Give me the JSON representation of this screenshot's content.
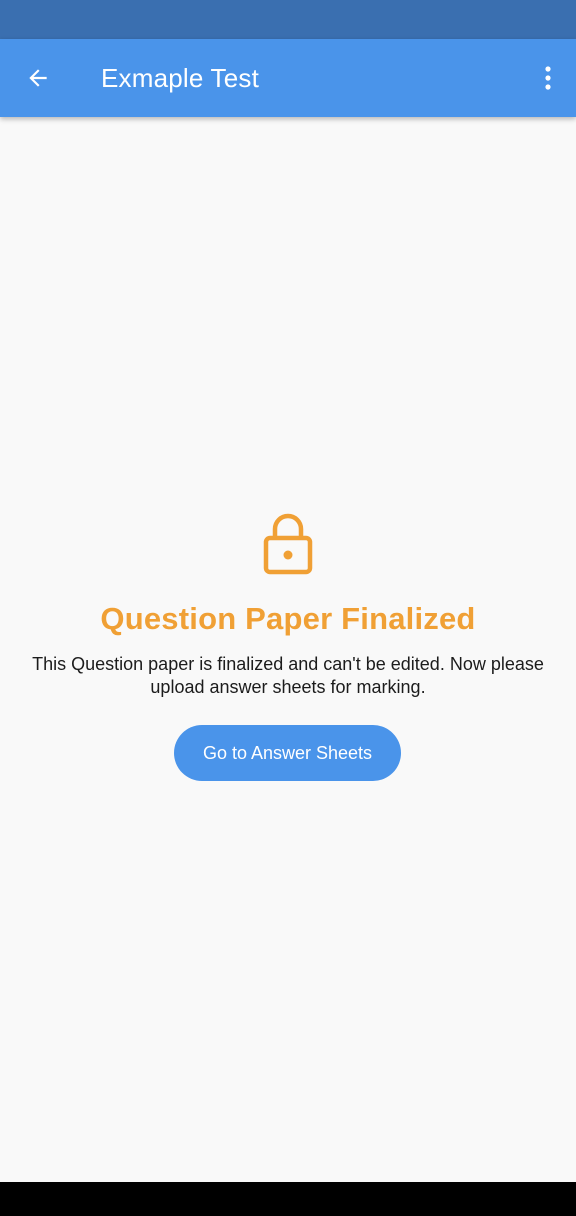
{
  "app_bar": {
    "title": "Exmaple Test",
    "back_icon": "arrow-left-icon",
    "menu_icon": "more-vertical-icon"
  },
  "main": {
    "icon": "lock-icon",
    "headline": "Question Paper Finalized",
    "description": "This Question paper is finalized and can't be edited. Now please upload answer sheets for marking.",
    "button_label": "Go to Answer Sheets"
  },
  "colors": {
    "status_bar": "#3a6fb0",
    "primary": "#4a94ea",
    "accent": "#f0a035",
    "background": "#f9f9f9",
    "text": "#1c1c1c"
  }
}
